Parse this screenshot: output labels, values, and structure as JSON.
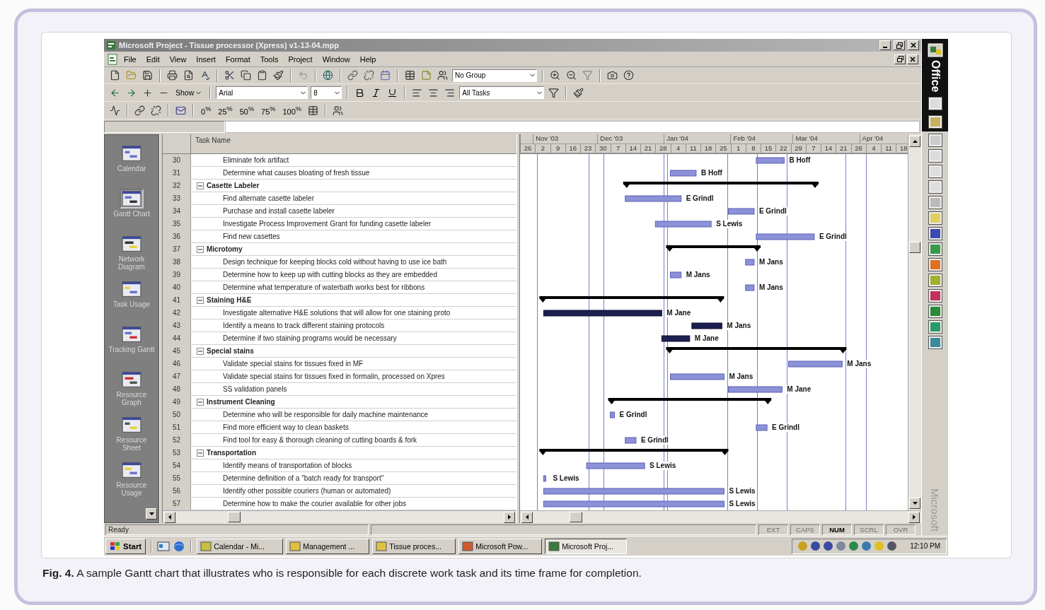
{
  "window": {
    "title": "Microsoft Project - Tissue processor (Xpress) v1-13-04.mpp"
  },
  "menu": [
    "File",
    "Edit",
    "View",
    "Insert",
    "Format",
    "Tools",
    "Project",
    "Window",
    "Help"
  ],
  "toolbar": {
    "group_by": "No Group",
    "show": "Show",
    "font": "Arial",
    "font_size": "8",
    "filter": "All Tasks",
    "percent_buttons": [
      "0$^{%}$",
      "25$^{%}$",
      "50$^{%}$",
      "75$^{%}$",
      "100$^{%}$"
    ]
  },
  "views": [
    {
      "label": "Calendar",
      "selected": false
    },
    {
      "label": "Gantt Chart",
      "selected": true
    },
    {
      "label": "Network Diagram",
      "selected": false
    },
    {
      "label": "Task Usage",
      "selected": false
    },
    {
      "label": "Tracking Gantt",
      "selected": false
    },
    {
      "label": "Resource Graph",
      "selected": false
    },
    {
      "label": "Resource Sheet",
      "selected": false
    },
    {
      "label": "Resource Usage",
      "selected": false
    }
  ],
  "task_table": {
    "header": "Task Name",
    "rows": [
      {
        "id": "30",
        "name": "Eliminate fork artifact",
        "kind": "task",
        "complete": false,
        "resource": "B Hoff"
      },
      {
        "id": "31",
        "name": "Determine what causes bloating of fresh tissue",
        "kind": "task",
        "complete": false,
        "resource": "B Hoff"
      },
      {
        "id": "32",
        "name": "Casette Labeler",
        "kind": "summary",
        "expanded": true
      },
      {
        "id": "33",
        "name": "Find alternate casette labeler",
        "kind": "task",
        "complete": false,
        "resource": "E Grindl"
      },
      {
        "id": "34",
        "name": "Purchase and install casette labeler",
        "kind": "task",
        "complete": false,
        "resource": "E Grindl"
      },
      {
        "id": "35",
        "name": "Investigate Process Improvement Grant for funding casette labeler",
        "kind": "task",
        "complete": false,
        "resource": "S Lewis"
      },
      {
        "id": "36",
        "name": "Find new casettes",
        "kind": "task",
        "complete": false,
        "resource": "E Grindl"
      },
      {
        "id": "37",
        "name": "Microtomy",
        "kind": "summary",
        "expanded": true
      },
      {
        "id": "38",
        "name": "Design technique for keeping blocks cold without having to use ice bath",
        "kind": "task",
        "complete": false,
        "resource": "M Jans"
      },
      {
        "id": "39",
        "name": "Determine how to keep up with cutting blocks as they are embedded",
        "kind": "task",
        "complete": false,
        "resource": "M Jans"
      },
      {
        "id": "40",
        "name": "Determine what temperature of waterbath works best for ribbons",
        "kind": "task",
        "complete": false,
        "resource": "M Jans"
      },
      {
        "id": "41",
        "name": "Staining H&E",
        "kind": "summary",
        "expanded": true
      },
      {
        "id": "42",
        "name": "Investigate alternative H&E solutions that will allow for one staining proto",
        "kind": "task",
        "complete": true,
        "resource": "M Jane"
      },
      {
        "id": "43",
        "name": "Identify a means to track different staining protocols",
        "kind": "task",
        "complete": true,
        "resource": "M Jans"
      },
      {
        "id": "44",
        "name": "Determine if two staining programs would be necessary",
        "kind": "task",
        "complete": true,
        "resource": "M Jane"
      },
      {
        "id": "45",
        "name": "Special stains",
        "kind": "summary",
        "expanded": true
      },
      {
        "id": "46",
        "name": "Validate special stains for tissues fixed in MF",
        "kind": "task",
        "complete": false,
        "resource": "M Jans"
      },
      {
        "id": "47",
        "name": "Validate special stains for tissues fixed in formalin, processed on Xpres",
        "kind": "task",
        "complete": false,
        "resource": "M Jans"
      },
      {
        "id": "48",
        "name": "SS validation panels",
        "kind": "task",
        "complete": false,
        "resource": "M Jane"
      },
      {
        "id": "49",
        "name": "Instrument Cleaning",
        "kind": "summary",
        "expanded": true
      },
      {
        "id": "50",
        "name": "Determine who will be responsible for daily machine maintenance",
        "kind": "task",
        "complete": false,
        "resource": "E Grindl"
      },
      {
        "id": "51",
        "name": "Find more efficient way to clean baskets",
        "kind": "task",
        "complete": false,
        "resource": "E Grindl"
      },
      {
        "id": "52",
        "name": "Find tool for easy & thorough cleaning of cutting boards & fork",
        "kind": "task",
        "complete": false,
        "resource": "E Grindl"
      },
      {
        "id": "53",
        "name": "Transportation",
        "kind": "summary",
        "expanded": true
      },
      {
        "id": "54",
        "name": "Identify means of transportation of blocks",
        "kind": "task",
        "complete": false,
        "resource": "S Lewis"
      },
      {
        "id": "55",
        "name": "Determine definition of a \"batch ready for transport\"",
        "kind": "task",
        "complete": false,
        "resource": "S Lewis"
      },
      {
        "id": "56",
        "name": "Identify other possible couriers (human or automated)",
        "kind": "task",
        "complete": false,
        "resource": "S Lewis"
      },
      {
        "id": "57",
        "name": "Determine how to make the courier available for other jobs",
        "kind": "task",
        "complete": false,
        "resource": "S Lewis"
      }
    ]
  },
  "gantt": {
    "months": [
      "Nov '03",
      "Dec '03",
      "Jan '04",
      "Feb '04",
      "Mar '04",
      "Apr '04"
    ],
    "weeks": [
      "26",
      "2",
      "9",
      "16",
      "23",
      "30",
      "7",
      "14",
      "21",
      "28",
      "4",
      "11",
      "18",
      "25",
      "1",
      "8",
      "15",
      "22",
      "29",
      "7",
      "14",
      "21",
      "28",
      "4",
      "11",
      "18"
    ]
  },
  "status_bar": {
    "text": "Ready",
    "indicators": [
      {
        "label": "EXT",
        "on": false
      },
      {
        "label": "CAPS",
        "on": false
      },
      {
        "label": "NUM",
        "on": true
      },
      {
        "label": "SCRL",
        "on": false
      },
      {
        "label": "OVR",
        "on": false
      }
    ]
  },
  "taskbar": {
    "start": "Start",
    "buttons": [
      {
        "label": "Calendar - Mi...",
        "selected": false
      },
      {
        "label": "Management ...",
        "selected": false
      },
      {
        "label": "Tissue proces...",
        "selected": false
      },
      {
        "label": "Microsoft Pow...",
        "selected": false
      },
      {
        "label": "Microsoft Proj...",
        "selected": true
      }
    ],
    "clock": "12:10 PM"
  },
  "office_bar": {
    "title": "Office",
    "footer": "Microsoft"
  },
  "caption": "**Fig. 4.** A sample Gantt chart that illustrates who is responsible for each discrete work task and its time frame for completion."
}
